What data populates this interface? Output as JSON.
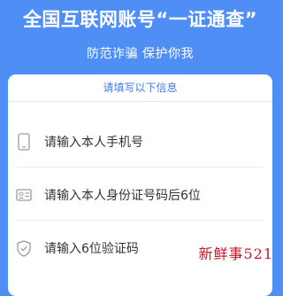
{
  "header": {
    "title": "全国互联网账号“一证通查”",
    "subtitle": "防范诈骗 保护你我"
  },
  "form": {
    "heading": "请填写以下信息",
    "fields": [
      {
        "placeholder": "请输入本人手机号",
        "icon": "phone-icon"
      },
      {
        "placeholder": "请输入本人身份证号码后6位",
        "icon": "id-card-icon"
      },
      {
        "placeholder": "请输入6位验证码",
        "icon": "shield-check-icon"
      }
    ]
  },
  "watermark": "新鲜事521",
  "colors": {
    "background": "#4f8ef5",
    "accent": "#3f7bea",
    "watermark": "#c9152a"
  }
}
